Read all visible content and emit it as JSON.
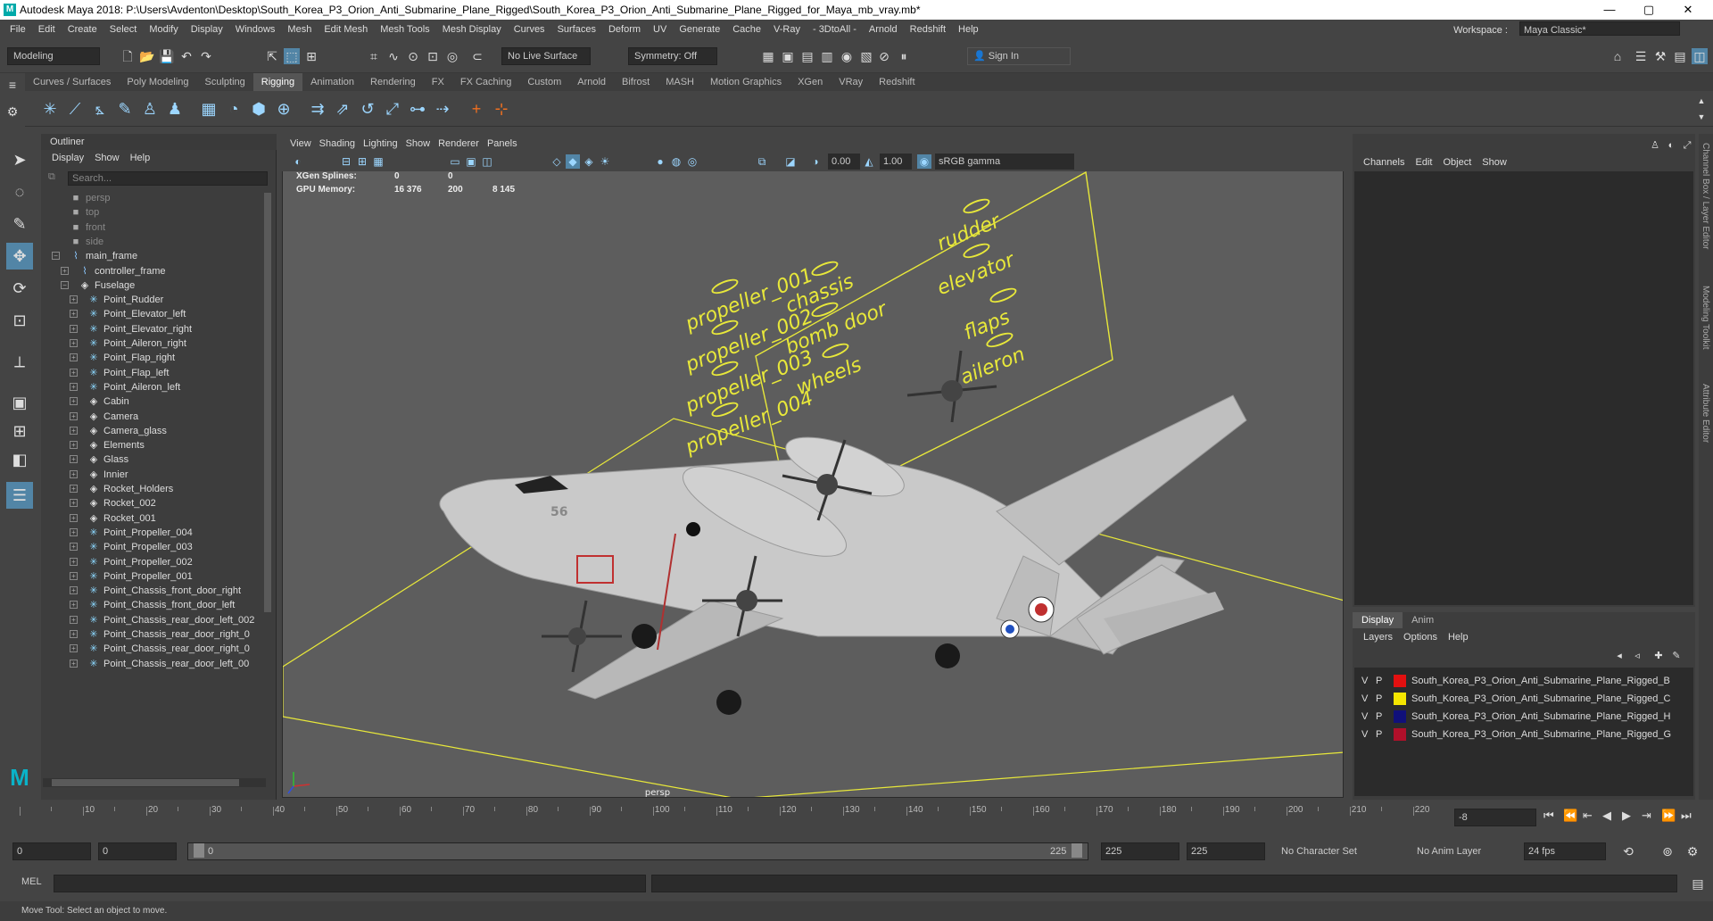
{
  "window": {
    "title": "Autodesk Maya 2018: P:\\Users\\Avdenton\\Desktop\\South_Korea_P3_Orion_Anti_Submarine_Plane_Rigged\\South_Korea_P3_Orion_Anti_Submarine_Plane_Rigged_for_Maya_mb_vray.mb*",
    "min": "—",
    "max": "▢",
    "close": "✕"
  },
  "menubar": {
    "items": [
      "File",
      "Edit",
      "Create",
      "Select",
      "Modify",
      "Display",
      "Windows",
      "Mesh",
      "Edit Mesh",
      "Mesh Tools",
      "Mesh Display",
      "Curves",
      "Surfaces",
      "Deform",
      "UV",
      "Generate",
      "Cache",
      "V-Ray",
      "- 3DtoAll -",
      "Arnold",
      "Redshift",
      "Help"
    ],
    "workspace_label": "Workspace :",
    "workspace_value": "Maya Classic*"
  },
  "statusline": {
    "mode": "Modeling",
    "live_surface": "No Live Surface",
    "symmetry": "Symmetry: Off",
    "sign_in": "Sign In"
  },
  "shelf": {
    "tabs": [
      "Curves / Surfaces",
      "Poly Modeling",
      "Sculpting",
      "Rigging",
      "Animation",
      "Rendering",
      "FX",
      "FX Caching",
      "Custom",
      "Arnold",
      "Bifrost",
      "MASH",
      "Motion Graphics",
      "XGen",
      "VRay",
      "Redshift"
    ],
    "active": "Rigging"
  },
  "outliner": {
    "title": "Outliner",
    "menu": [
      "Display",
      "Show",
      "Help"
    ],
    "search_placeholder": "Search...",
    "items": [
      {
        "label": "persp",
        "icon": "camera-icon",
        "indent": 0,
        "dim": true,
        "exp": ""
      },
      {
        "label": "top",
        "icon": "camera-icon",
        "indent": 0,
        "dim": true,
        "exp": ""
      },
      {
        "label": "front",
        "icon": "camera-icon",
        "indent": 0,
        "dim": true,
        "exp": ""
      },
      {
        "label": "side",
        "icon": "camera-icon",
        "indent": 0,
        "dim": true,
        "exp": ""
      },
      {
        "label": "main_frame",
        "icon": "curve-icon",
        "indent": 0,
        "dim": false,
        "exp": "−"
      },
      {
        "label": "controller_frame",
        "icon": "curve-icon",
        "indent": 1,
        "dim": false,
        "exp": "+"
      },
      {
        "label": "Fuselage",
        "icon": "mesh-icon",
        "indent": 1,
        "dim": false,
        "exp": "−"
      },
      {
        "label": "Point_Rudder",
        "icon": "joint-icon",
        "indent": 2,
        "dim": false,
        "exp": "+"
      },
      {
        "label": "Point_Elevator_left",
        "icon": "joint-icon",
        "indent": 2,
        "dim": false,
        "exp": "+"
      },
      {
        "label": "Point_Elevator_right",
        "icon": "joint-icon",
        "indent": 2,
        "dim": false,
        "exp": "+"
      },
      {
        "label": "Point_Aileron_right",
        "icon": "joint-icon",
        "indent": 2,
        "dim": false,
        "exp": "+"
      },
      {
        "label": "Point_Flap_right",
        "icon": "joint-icon",
        "indent": 2,
        "dim": false,
        "exp": "+"
      },
      {
        "label": "Point_Flap_left",
        "icon": "joint-icon",
        "indent": 2,
        "dim": false,
        "exp": "+"
      },
      {
        "label": "Point_Aileron_left",
        "icon": "joint-icon",
        "indent": 2,
        "dim": false,
        "exp": "+"
      },
      {
        "label": "Cabin",
        "icon": "mesh-icon",
        "indent": 2,
        "dim": false,
        "exp": "+"
      },
      {
        "label": "Camera",
        "icon": "mesh-icon",
        "indent": 2,
        "dim": false,
        "exp": "+"
      },
      {
        "label": "Camera_glass",
        "icon": "mesh-icon",
        "indent": 2,
        "dim": false,
        "exp": "+"
      },
      {
        "label": "Elements",
        "icon": "mesh-icon",
        "indent": 2,
        "dim": false,
        "exp": "+"
      },
      {
        "label": "Glass",
        "icon": "mesh-icon",
        "indent": 2,
        "dim": false,
        "exp": "+"
      },
      {
        "label": "Innier",
        "icon": "mesh-icon",
        "indent": 2,
        "dim": false,
        "exp": "+"
      },
      {
        "label": "Rocket_Holders",
        "icon": "mesh-icon",
        "indent": 2,
        "dim": false,
        "exp": "+"
      },
      {
        "label": "Rocket_002",
        "icon": "mesh-icon",
        "indent": 2,
        "dim": false,
        "exp": "+"
      },
      {
        "label": "Rocket_001",
        "icon": "mesh-icon",
        "indent": 2,
        "dim": false,
        "exp": "+"
      },
      {
        "label": "Point_Propeller_004",
        "icon": "joint-icon",
        "indent": 2,
        "dim": false,
        "exp": "+"
      },
      {
        "label": "Point_Propeller_003",
        "icon": "joint-icon",
        "indent": 2,
        "dim": false,
        "exp": "+"
      },
      {
        "label": "Point_Propeller_002",
        "icon": "joint-icon",
        "indent": 2,
        "dim": false,
        "exp": "+"
      },
      {
        "label": "Point_Propeller_001",
        "icon": "joint-icon",
        "indent": 2,
        "dim": false,
        "exp": "+"
      },
      {
        "label": "Point_Chassis_front_door_right",
        "icon": "joint-icon",
        "indent": 2,
        "dim": false,
        "exp": "+"
      },
      {
        "label": "Point_Chassis_front_door_left",
        "icon": "joint-icon",
        "indent": 2,
        "dim": false,
        "exp": "+"
      },
      {
        "label": "Point_Chassis_rear_door_left_002",
        "icon": "joint-icon",
        "indent": 2,
        "dim": false,
        "exp": "+"
      },
      {
        "label": "Point_Chassis_rear_door_right_0",
        "icon": "joint-icon",
        "indent": 2,
        "dim": false,
        "exp": "+"
      },
      {
        "label": "Point_Chassis_rear_door_right_0",
        "icon": "joint-icon",
        "indent": 2,
        "dim": false,
        "exp": "+"
      },
      {
        "label": "Point_Chassis_rear_door_left_00",
        "icon": "joint-icon",
        "indent": 2,
        "dim": false,
        "exp": "+"
      }
    ]
  },
  "viewport": {
    "menu": [
      "View",
      "Shading",
      "Lighting",
      "Show",
      "Renderer",
      "Panels"
    ],
    "exposure": "0.00",
    "gamma": "1.00",
    "color_space": "sRGB gamma",
    "hud": [
      {
        "label": "XGen Splines:",
        "a": "0",
        "b": "0",
        "c": ""
      },
      {
        "label": "GPU Memory:",
        "a": "16 376",
        "b": "200",
        "c": "8 145"
      }
    ],
    "camera_label": "persp",
    "controller_labels": [
      "propeller_001",
      "propeller_002",
      "propeller_003",
      "propeller_004",
      "chassis",
      "bomb door",
      "wheels",
      "rudder",
      "elevator",
      "flaps",
      "aileron"
    ],
    "tail_number": "56"
  },
  "channelbox": {
    "menu": [
      "Channels",
      "Edit",
      "Object",
      "Show"
    ]
  },
  "layers": {
    "tabs": [
      "Display",
      "Anim"
    ],
    "menu": [
      "Layers",
      "Options",
      "Help"
    ],
    "rows": [
      {
        "v": "V",
        "p": "P",
        "color": "#e31010",
        "name": "South_Korea_P3_Orion_Anti_Submarine_Plane_Rigged_B"
      },
      {
        "v": "V",
        "p": "P",
        "color": "#f5e600",
        "name": "South_Korea_P3_Orion_Anti_Submarine_Plane_Rigged_C"
      },
      {
        "v": "V",
        "p": "P",
        "color": "#10107a",
        "name": "South_Korea_P3_Orion_Anti_Submarine_Plane_Rigged_H"
      },
      {
        "v": "V",
        "p": "P",
        "color": "#b0102a",
        "name": "South_Korea_P3_Orion_Anti_Submarine_Plane_Rigged_G"
      }
    ]
  },
  "sidebar_tabs": [
    "Channel Box / Layer Editor",
    "Modeling Toolkit",
    "Attribute Editor"
  ],
  "timeline": {
    "ticks": [
      "10",
      "20",
      "30",
      "40",
      "50",
      "60",
      "70",
      "80",
      "90",
      "100",
      "110",
      "120",
      "130",
      "140",
      "150",
      "160",
      "170",
      "180",
      "190",
      "200",
      "210",
      "220"
    ],
    "current_frame": "-8"
  },
  "range": {
    "start": "0",
    "start2": "0",
    "slider_start": "0",
    "slider_end": "225",
    "end": "225",
    "end2": "225",
    "character_set": "No Character Set",
    "anim_layer": "No Anim Layer",
    "fps": "24 fps"
  },
  "mel": {
    "label": "MEL"
  },
  "helpline": {
    "text": "Move Tool: Select an object to move."
  }
}
